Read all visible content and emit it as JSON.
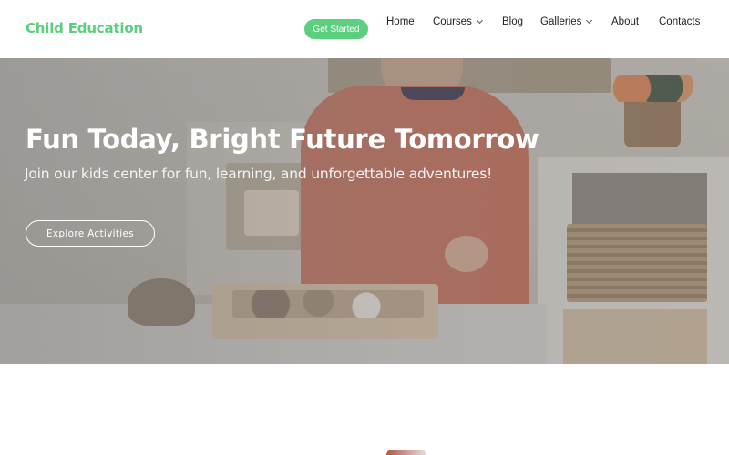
{
  "header": {
    "logo": "Child Education",
    "cta_label": "Get Started",
    "nav": [
      {
        "label": "Home",
        "dropdown": false
      },
      {
        "label": "Courses",
        "dropdown": true
      },
      {
        "label": "Blog",
        "dropdown": false
      },
      {
        "label": "Galleries",
        "dropdown": true
      },
      {
        "label": "About",
        "dropdown": false
      },
      {
        "label": "Contacts",
        "dropdown": false
      }
    ]
  },
  "hero": {
    "title": "Fun Today, Bright Future Tomorrow",
    "subtitle": "Join our kids center for fun, learning, and unforgettable adventures!",
    "button_label": "Explore Activities",
    "image_alt": "Child playing with wooden toys and sensory tray at a table"
  },
  "colors": {
    "brand": "#5bcf7d",
    "nav_text": "#222222",
    "hero_text": "#ffffff"
  }
}
